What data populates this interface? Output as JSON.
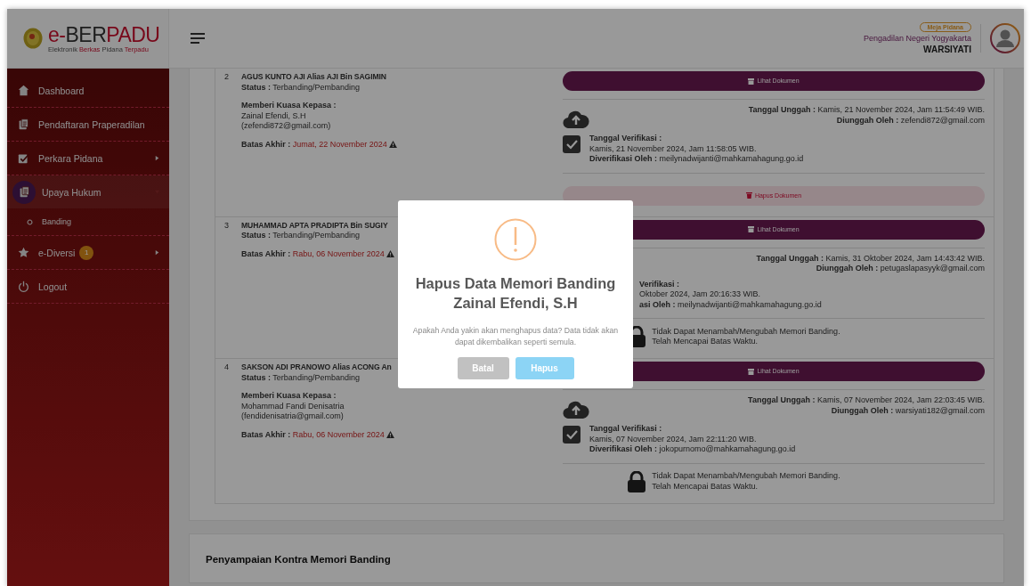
{
  "header": {
    "logo_title": [
      {
        "text": "e-",
        "accent": true
      },
      {
        "text": "BER",
        "accent": false
      },
      {
        "text": "PADU",
        "accent": true
      }
    ],
    "logo_subtitle": [
      {
        "text": "Elektronik",
        "accent": false
      },
      {
        "text": "Berkas",
        "accent": true
      },
      {
        "text": "Pidana",
        "accent": false
      },
      {
        "text": "Terpadu",
        "accent": true
      }
    ],
    "role_badge": "Meja Pidana",
    "court": "Pengadilan Negeri Yogyakarta",
    "user": "WARSIYATI"
  },
  "sidebar": {
    "items": [
      {
        "label": "Dashboard",
        "kind": "home",
        "selected": false
      },
      {
        "label": "Pendaftaran Praperadilan",
        "kind": "pages",
        "selected": false
      },
      {
        "label": "Perkara Pidana",
        "kind": "edit",
        "selected": false,
        "expanded": false
      },
      {
        "label": "Upaya Hukum",
        "kind": "pages",
        "selected": true,
        "expanded": true,
        "children": [
          {
            "label": "Banding",
            "selected": false
          }
        ]
      },
      {
        "label": "e-Diversi",
        "kind": "star",
        "selected": false,
        "expanded": false,
        "badge": "1"
      },
      {
        "label": "Logout",
        "kind": "power",
        "selected": false
      }
    ]
  },
  "rows": [
    {
      "number": "2",
      "name": "AGUS KUNTO AJI Alias AJI Bin SAGIMIN",
      "status": {
        "label": "Status :",
        "value": "Terbanding/Pembanding"
      },
      "kuasa": {
        "label": "Memberi Kuasa Kepasa :",
        "name": "Zainal Efendi, S.H",
        "email": "(zefendi872@gmail.com)"
      },
      "deadline": {
        "label": "Batas Akhir :",
        "value": "Jumat, 22 November 2024"
      },
      "view_button": "Lihat Dokumen",
      "icons_visible": true,
      "upload": {
        "date_label": "Tanggal Unggah :",
        "date": "Kamis, 21 November 2024, Jam 11:54:49 WIB.",
        "by_label": "Diunggah Oleh :",
        "by": "zefendi872@gmail.com"
      },
      "verification": {
        "label": "Tanggal Verifikasi :",
        "date": "Kamis, 21 November 2024, Jam 11:58:05 WIB.",
        "by_label": "Diverifikasi Oleh :",
        "by": "meilynadwijanti@mahkamahagung.go.id"
      },
      "delete_button": "Hapus Dokumen"
    },
    {
      "number": "3",
      "name": "MUHAMMAD APTA PRADIPTA Bin SUGIY",
      "status": {
        "label": "Status :",
        "value": "Terbanding/Pembanding"
      },
      "deadline": {
        "label": "Batas Akhir :",
        "value": "Rabu, 06 November 2024"
      },
      "view_button": "Lihat Dokumen",
      "icons_visible": false,
      "upload": {
        "date_label": "Tanggal Unggah :",
        "date": "Kamis, 31 Oktober 2024, Jam 14:43:42 WIB.",
        "by_label": "Diunggah Oleh :",
        "by": "petugaslapasyyk@gmail.com"
      },
      "verification": {
        "label": "Verifikasi :",
        "date": "Oktober 2024, Jam 20:16:33 WIB.",
        "by_label": "asi Oleh :",
        "by": "meilynadwijanti@mahkamahagung.go.id"
      },
      "lock_message": [
        "Tidak Dapat Menambah/Mengubah Memori Banding.",
        "Telah Mencapai Batas Waktu."
      ]
    },
    {
      "number": "4",
      "name": "SAKSON ADI PRANOWO Alias ACONG An",
      "status": {
        "label": "Status :",
        "value": "Terbanding/Pembanding"
      },
      "kuasa": {
        "label": "Memberi Kuasa Kepasa :",
        "name": "Mohammad Fandi Denisatria",
        "email": "(fendidenisatria@gmail.com)"
      },
      "deadline": {
        "label": "Batas Akhir :",
        "value": "Rabu, 06 November 2024"
      },
      "view_button": "Lihat Dokumen",
      "icons_visible": true,
      "upload": {
        "date_label": "Tanggal Unggah :",
        "date": "Kamis, 07 November 2024, Jam 22:03:45 WIB.",
        "by_label": "Diunggah Oleh :",
        "by": "warsiyati182@gmail.com"
      },
      "verification": {
        "label": "Tanggal Verifikasi :",
        "date": "Kamis, 07 November 2024, Jam 22:11:20 WIB.",
        "by_label": "Diverifikasi Oleh :",
        "by": "jokopurnomo@mahkamahagung.go.id"
      },
      "lock_message": [
        "Tidak Dapat Menambah/Mengubah Memori Banding.",
        "Telah Mencapai Batas Waktu."
      ]
    }
  ],
  "section_title": "Penyampaian Kontra Memori Banding",
  "modal": {
    "title_lines": [
      "Hapus Data Memori Banding",
      "Zainal Efendi, S.H"
    ],
    "message": "Apakah Anda yakin akan menghapus data? Data tidak akan dapat dikembalikan seperti semula.",
    "buttons": [
      {
        "label": "Batal",
        "kind": "cancel"
      },
      {
        "label": "Hapus",
        "kind": "confirm"
      }
    ]
  }
}
